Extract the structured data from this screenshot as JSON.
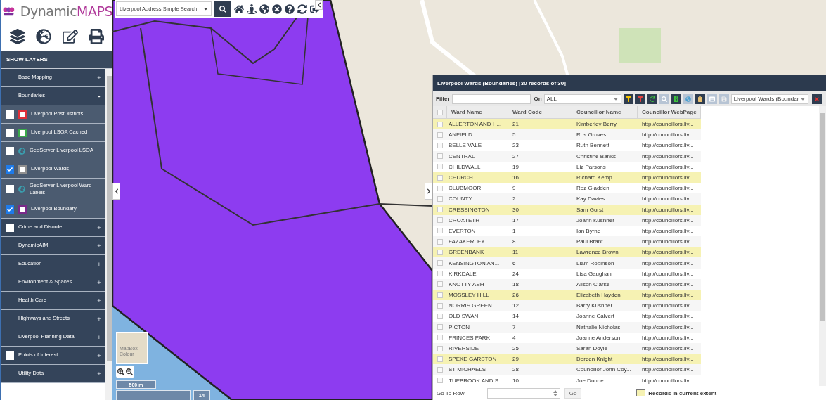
{
  "logo": {
    "prefix": "Dynamic",
    "suffix": "MAPS"
  },
  "search": {
    "value": "Liverpool Address Simple Search"
  },
  "sidebar": {
    "header": "SHOW LAYERS",
    "items": [
      {
        "kind": "group",
        "label": "Base Mapping",
        "toggle": "+",
        "expanded": false
      },
      {
        "kind": "group",
        "label": "Boundaries",
        "toggle": "-",
        "expanded": true,
        "children": [
          {
            "kind": "swatch",
            "label": "Liverpool PostDistricts",
            "checked": false,
            "color": "#e0303a"
          },
          {
            "kind": "swatch",
            "label": "Liverpool LSOA Cached",
            "checked": false,
            "color": "#3aa84a"
          },
          {
            "kind": "globe",
            "label": "GeoServer Liverpool LSOA",
            "checked": false
          },
          {
            "kind": "swatch",
            "label": "Liverpool Wards",
            "checked": true,
            "color": "#909090"
          },
          {
            "kind": "globe",
            "label": "GeoServer Liverpool Ward Labels",
            "checked": false
          },
          {
            "kind": "swatch",
            "label": "Liverpool Boundary",
            "checked": true,
            "color": "#7a2a8a"
          }
        ]
      },
      {
        "kind": "checkgroup",
        "label": "Crime and Disorder",
        "toggle": "+",
        "expanded": false,
        "checked": false
      },
      {
        "kind": "group",
        "label": "DynamicAIM",
        "toggle": "+",
        "expanded": false
      },
      {
        "kind": "group",
        "label": "Education",
        "toggle": "+",
        "expanded": false
      },
      {
        "kind": "group",
        "label": "Environment & Spaces",
        "toggle": "+",
        "expanded": false
      },
      {
        "kind": "group",
        "label": "Health Care",
        "toggle": "+",
        "expanded": false
      },
      {
        "kind": "group",
        "label": "Highways and Streets",
        "toggle": "+",
        "expanded": false
      },
      {
        "kind": "group",
        "label": "Liverpool Planning Data",
        "toggle": "+",
        "expanded": false
      },
      {
        "kind": "checkgroup",
        "label": "Points of Interest",
        "toggle": "+",
        "expanded": false,
        "checked": false
      },
      {
        "kind": "group",
        "label": "Utility Data",
        "toggle": "+",
        "expanded": false
      }
    ]
  },
  "map": {
    "basemap_label": "MapBox Colour",
    "scale": "500 m",
    "zoom_level": "14"
  },
  "grid": {
    "title": "Liverpool Wards (Boundaries) [30 records of 30]",
    "filter_label": "Filter",
    "on_label": "On",
    "on_value": "ALL",
    "layer_value": "Liverpool Wards (Boundar",
    "columns": [
      "Ward Name",
      "Ward Code",
      "Councillor Name",
      "Councillor WebPage"
    ],
    "rows": [
      {
        "cells": [
          "ALLERTON AND H...",
          "21",
          "Kimberley Berry",
          "http://councillors.liv..."
        ],
        "highlighted": true
      },
      {
        "cells": [
          "ANFIELD",
          "5",
          "Ros Groves",
          "http://councillors.liv..."
        ],
        "highlighted": false
      },
      {
        "cells": [
          "BELLE VALE",
          "23",
          "Ruth Bennett",
          "http://councillors.liv..."
        ],
        "highlighted": false
      },
      {
        "cells": [
          "CENTRAL",
          "27",
          "Christine Banks",
          "http://councillors.liv..."
        ],
        "highlighted": false
      },
      {
        "cells": [
          "CHILDWALL",
          "19",
          "Liz Parsons",
          "http://councillors.liv..."
        ],
        "highlighted": false
      },
      {
        "cells": [
          "CHURCH",
          "16",
          "Richard Kemp",
          "http://councillors.liv..."
        ],
        "highlighted": true
      },
      {
        "cells": [
          "CLUBMOOR",
          "9",
          "Roz Gladden",
          "http://councillors.liv..."
        ],
        "highlighted": false
      },
      {
        "cells": [
          "COUNTY",
          "2",
          "Kay Davies",
          "http://councillors.liv..."
        ],
        "highlighted": false
      },
      {
        "cells": [
          "CRESSINGTON",
          "30",
          "Sam Gorst",
          "http://councillors.liv..."
        ],
        "highlighted": true
      },
      {
        "cells": [
          "CROXTETH",
          "17",
          "Joann Kushner",
          "http://councillors.liv..."
        ],
        "highlighted": false
      },
      {
        "cells": [
          "EVERTON",
          "1",
          "Ian Byrne",
          "http://councillors.liv..."
        ],
        "highlighted": false
      },
      {
        "cells": [
          "FAZAKERLEY",
          "8",
          "Paul Brant",
          "http://councillors.liv..."
        ],
        "highlighted": false
      },
      {
        "cells": [
          "GREENBANK",
          "11",
          "Lawrence Brown",
          "http://councillors.liv..."
        ],
        "highlighted": true
      },
      {
        "cells": [
          "KENSINGTON AN...",
          "6",
          "Liam Robinson",
          "http://councillors.liv..."
        ],
        "highlighted": false
      },
      {
        "cells": [
          "KIRKDALE",
          "24",
          "Lisa Gaughan",
          "http://councillors.liv..."
        ],
        "highlighted": false
      },
      {
        "cells": [
          "KNOTTY ASH",
          "18",
          "Alison Clarke",
          "http://councillors.liv..."
        ],
        "highlighted": false
      },
      {
        "cells": [
          "MOSSLEY HILL",
          "26",
          "Elizabeth Hayden",
          "http://councillors.liv..."
        ],
        "highlighted": true
      },
      {
        "cells": [
          "NORRIS GREEN",
          "12",
          "Barry Kushner",
          "http://councillors.liv..."
        ],
        "highlighted": false
      },
      {
        "cells": [
          "OLD SWAN",
          "14",
          "Joanne Calvert",
          "http://councillors.liv..."
        ],
        "highlighted": false
      },
      {
        "cells": [
          "PICTON",
          "7",
          "Nathalie Nicholas",
          "http://councillors.liv..."
        ],
        "highlighted": false
      },
      {
        "cells": [
          "PRINCES PARK",
          "4",
          "Joanne Anderson",
          "http://councillors.liv..."
        ],
        "highlighted": false
      },
      {
        "cells": [
          "RIVERSIDE",
          "25",
          "Sarah Doyle",
          "http://councillors.liv..."
        ],
        "highlighted": false
      },
      {
        "cells": [
          "SPEKE GARSTON",
          "29",
          "Doreen Knight",
          "http://councillors.liv..."
        ],
        "highlighted": true
      },
      {
        "cells": [
          "ST MICHAELS",
          "28",
          "Councillor John Coy...",
          "http://councillors.liv..."
        ],
        "highlighted": false
      },
      {
        "cells": [
          "TUEBROOK AND S...",
          "10",
          "Joe Dunne",
          "http://councillors.liv..."
        ],
        "highlighted": false
      }
    ],
    "goto_label": "Go To Row:",
    "go_button": "Go",
    "legend_label": "Records in current extent"
  }
}
